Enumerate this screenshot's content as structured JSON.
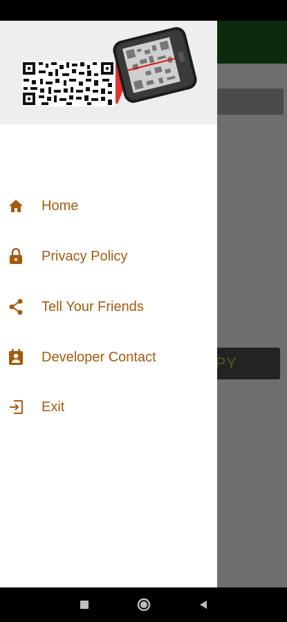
{
  "drawer": {
    "menu": [
      {
        "label": "Home",
        "icon": "home-icon"
      },
      {
        "label": "Privacy Policy",
        "icon": "lock-icon"
      },
      {
        "label": "Tell Your Friends",
        "icon": "share-icon"
      },
      {
        "label": "Developer Contact",
        "icon": "contact-icon"
      },
      {
        "label": "Exit",
        "icon": "exit-icon"
      }
    ]
  },
  "background_app": {
    "copy_button_label": "PY"
  },
  "colors": {
    "accent": "#a65a0c",
    "scan_red": "#e01010",
    "toolbar": "#0c2a0c"
  }
}
